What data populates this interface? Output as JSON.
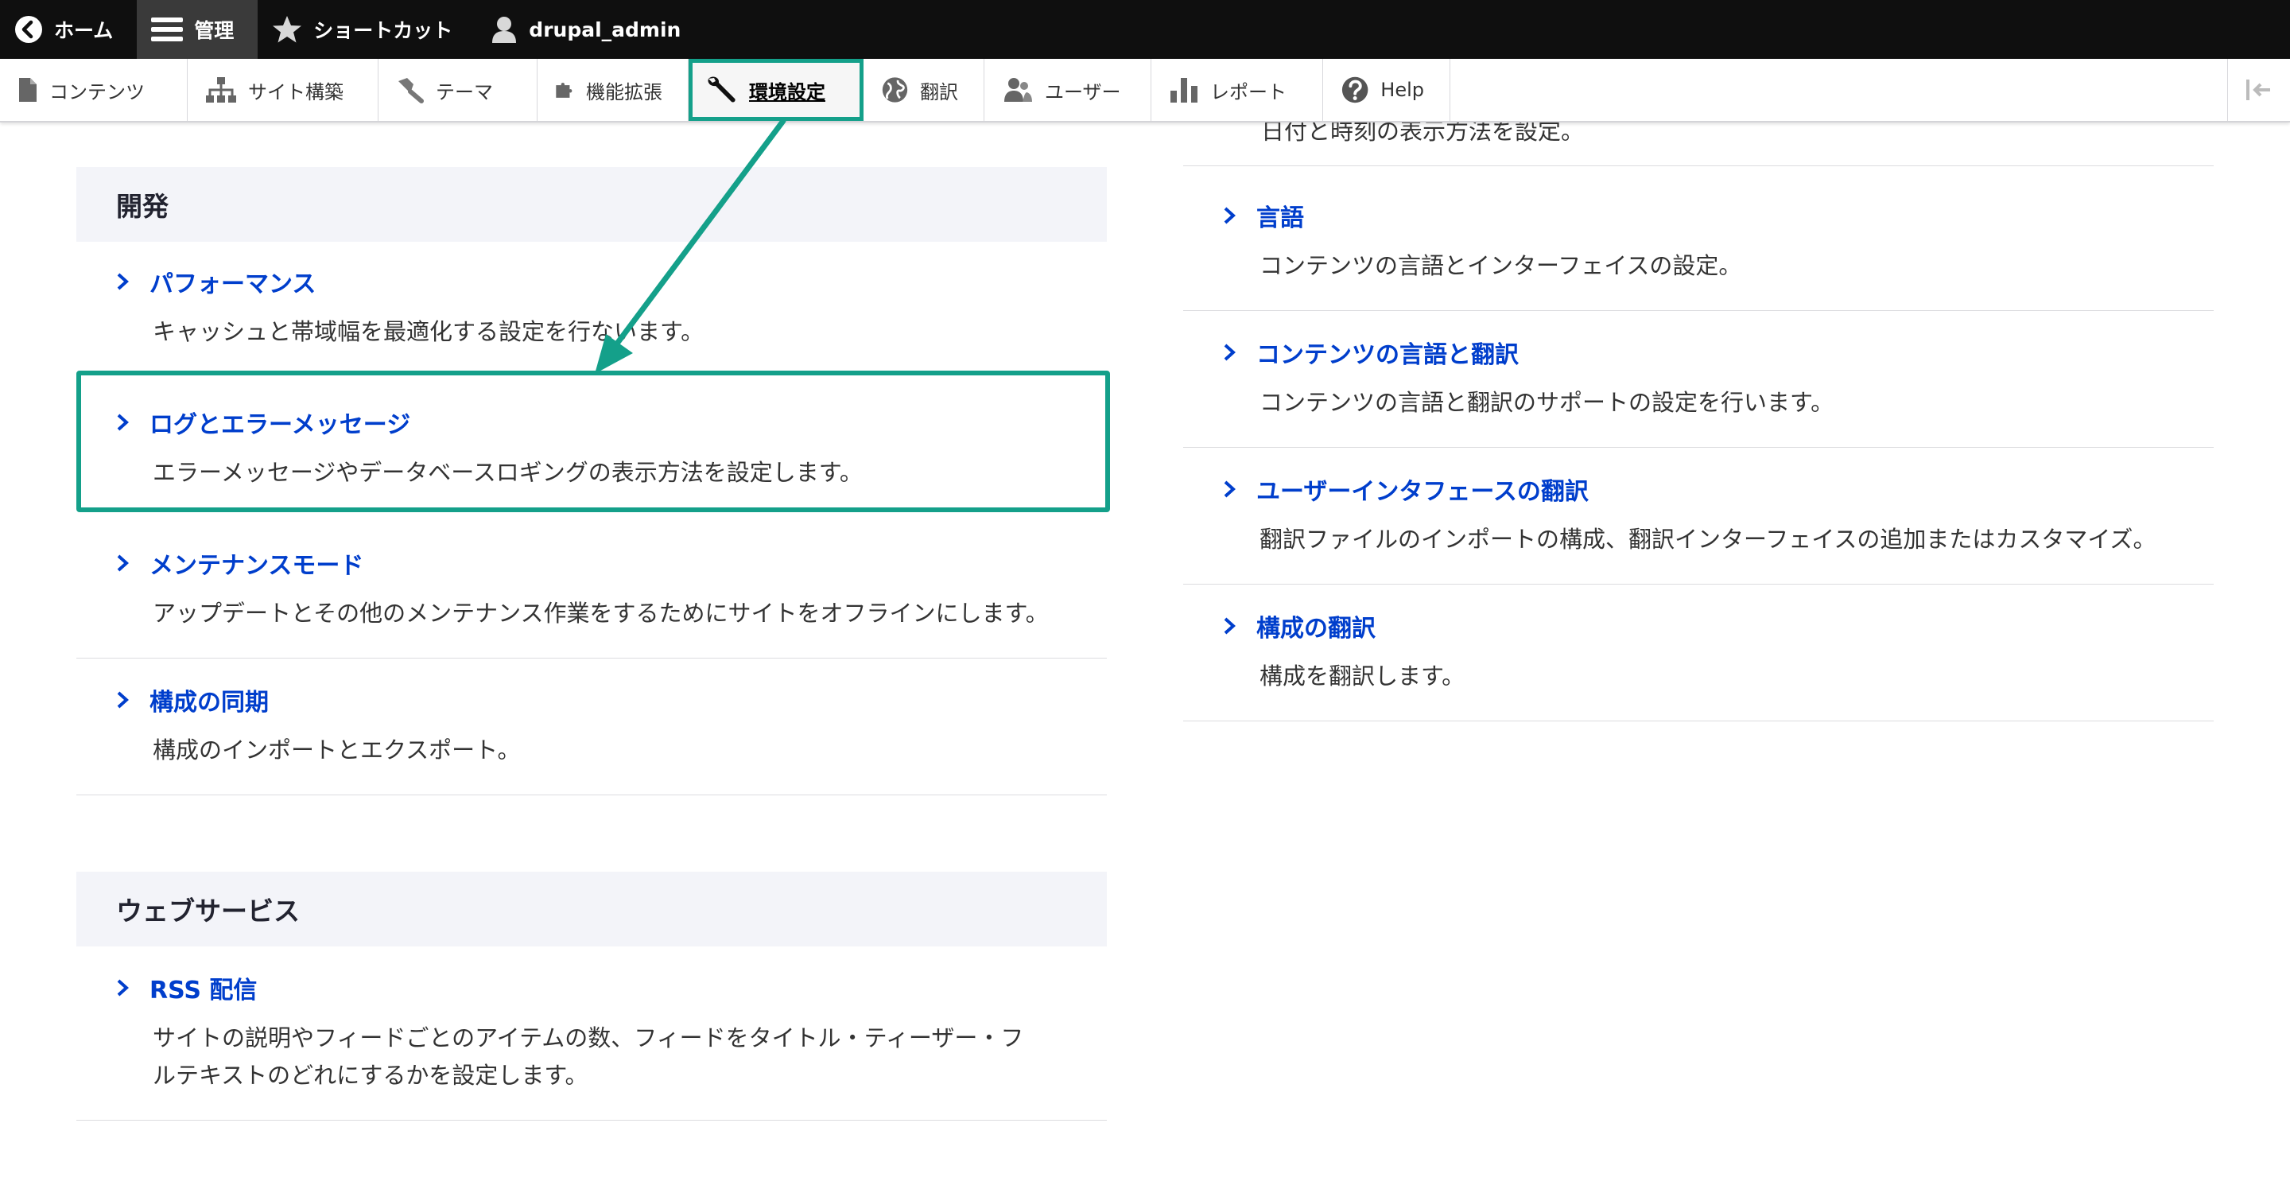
{
  "toolbar": {
    "home": "ホーム",
    "manage": "管理",
    "shortcuts": "ショートカット",
    "user": "drupal_admin"
  },
  "tray": {
    "items": [
      {
        "label": "コンテンツ",
        "icon": "file-icon"
      },
      {
        "label": "サイト構築",
        "icon": "sitemap-icon"
      },
      {
        "label": "テーマ",
        "icon": "paintbrush-icon"
      },
      {
        "label": "機能拡張",
        "icon": "puzzle-icon"
      },
      {
        "label": "環境設定",
        "icon": "wrench-icon",
        "active": true
      },
      {
        "label": "翻訳",
        "icon": "globe-icon"
      },
      {
        "label": "ユーザー",
        "icon": "users-icon"
      },
      {
        "label": "レポート",
        "icon": "bar-chart-icon"
      },
      {
        "label": "Help",
        "icon": "help-icon"
      }
    ]
  },
  "left": {
    "dev_title": "開発",
    "dev_items": [
      {
        "title": "パフォーマンス",
        "desc": "キャッシュと帯域幅を最適化する設定を行ないます。"
      },
      {
        "title": "ログとエラーメッセージ",
        "desc": "エラーメッセージやデータベースロギングの表示方法を設定します。"
      },
      {
        "title": "メンテナンスモード",
        "desc": "アップデートとその他のメンテナンス作業をするためにサイトをオフラインにします。"
      },
      {
        "title": "構成の同期",
        "desc": "構成のインポートとエクスポート。"
      }
    ],
    "web_title": "ウェブサービス",
    "web_items": [
      {
        "title": "RSS 配信",
        "desc": "サイトの説明やフィードごとのアイテムの数、フィードをタイトル・ティーザー・フルテキストのどれにするかを設定します。"
      }
    ]
  },
  "right": {
    "partial_desc": "日付と時刻の表示方法を設定。",
    "items": [
      {
        "title": "言語",
        "desc": "コンテンツの言語とインターフェイスの設定。"
      },
      {
        "title": "コンテンツの言語と翻訳",
        "desc": "コンテンツの言語と翻訳のサポートの設定を行います。"
      },
      {
        "title": "ユーザーインタフェースの翻訳",
        "desc": "翻訳ファイルのインポートの構成、翻訳インターフェイスの追加またはカスタマイズ。"
      },
      {
        "title": "構成の翻訳",
        "desc": "構成を翻訳します。"
      }
    ]
  },
  "colors": {
    "accent": "#14a08a",
    "link": "#003ecc",
    "toolbar": "#0f0f0f"
  }
}
